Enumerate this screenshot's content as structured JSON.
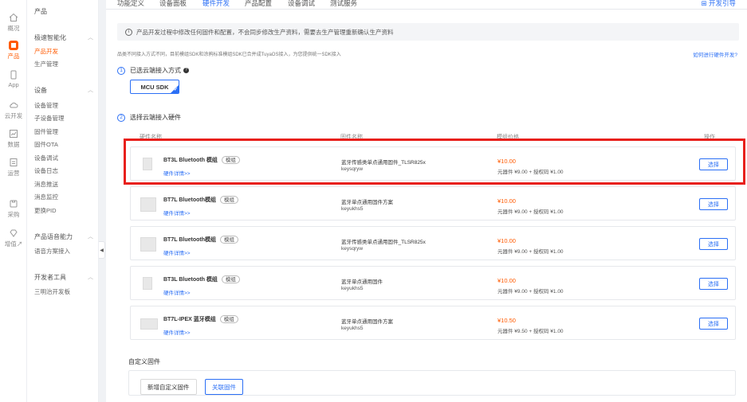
{
  "rail": [
    {
      "label": "概况",
      "icon": "home-icon"
    },
    {
      "label": "产品",
      "icon": "product-icon",
      "active": true
    },
    {
      "label": "App",
      "icon": "phone-icon"
    },
    {
      "label": "云开发",
      "icon": "cloud-icon"
    },
    {
      "label": "数据",
      "icon": "chart-icon"
    },
    {
      "label": "运营",
      "icon": "operation-icon"
    },
    {
      "label": "采购",
      "icon": "purchase-icon"
    },
    {
      "label": "增值",
      "icon": "diamond-icon",
      "suffix": "↗"
    }
  ],
  "sidebar": {
    "title": "产品",
    "groups": [
      {
        "label": "极速智能化",
        "items": [
          "产品开发",
          "生产管理"
        ]
      },
      {
        "label": "设备",
        "items": [
          "设备管理",
          "子设备管理",
          "固件管理",
          "固件OTA",
          "设备调试",
          "设备日志",
          "消息推送",
          "消息监控",
          "更换PID"
        ]
      },
      {
        "label": "产品语音能力",
        "items": [
          "语音方案接入"
        ]
      },
      {
        "label": "开发者工具",
        "items": [
          "三明治开发板"
        ]
      }
    ],
    "active_item": "产品开发"
  },
  "tabs": [
    "功能定义",
    "设备面板",
    "硬件开发",
    "产品配置",
    "设备调试",
    "测试服务"
  ],
  "active_tab": "硬件开发",
  "dev_guide": "开发引导",
  "notice": "产品开发过程中修改任何固件和配置，不会同步修改生产资料，需要去生产管理重新确认生产资料",
  "hint": "品类不同接入方式不同，目前模组SDK和涂鸦标准模组SDK已合并成TuyaOS接入，为您提供统一SDK接入",
  "hint_link": "如何进行硬件开发?",
  "step1": {
    "num": "1",
    "label": "已选云端接入方式",
    "selected": "MCU SDK"
  },
  "step2": {
    "num": "2",
    "label": "选择云端接入硬件"
  },
  "hw_columns": [
    "硬件名称",
    "固件名称",
    "模组价格",
    "操作"
  ],
  "hardware": [
    {
      "name": "BT3L Bluetooth 模组",
      "tag": "模组",
      "detail": "硬件详情>>",
      "firmware": "蓝牙传感类单点通用固件_TLSR825x",
      "code": "keysqryw",
      "price": "¥10.00",
      "breakdown": "元器件 ¥9.00 + 授权码 ¥1.00",
      "action": "选择",
      "thumb": "small"
    },
    {
      "name": "BT7L Bluetooth模组",
      "tag": "模组",
      "detail": "硬件详情>>",
      "firmware": "蓝牙单点通用固件方案",
      "code": "keyukhs5",
      "price": "¥10.00",
      "breakdown": "元器件 ¥9.00 + 授权码 ¥1.00",
      "action": "选择",
      "thumb": "normal"
    },
    {
      "name": "BT7L Bluetooth模组",
      "tag": "模组",
      "detail": "硬件详情>>",
      "firmware": "蓝牙传感类单点通用固件_TLSR825x",
      "code": "keysqryw",
      "price": "¥10.00",
      "breakdown": "元器件 ¥9.00 + 授权码 ¥1.00",
      "action": "选择",
      "thumb": "normal"
    },
    {
      "name": "BT3L Bluetooth 模组",
      "tag": "模组",
      "detail": "硬件详情>>",
      "firmware": "蓝牙单点通用固件",
      "code": "keyukhs5",
      "price": "¥10.00",
      "breakdown": "元器件 ¥9.00 + 授权码 ¥1.00",
      "action": "选择",
      "thumb": "small"
    },
    {
      "name": "BT7L-IPEX 蓝牙模组",
      "tag": "模组",
      "detail": "硬件详情>>",
      "firmware": "蓝牙单点通用固件方案",
      "code": "keyukhs5",
      "price": "¥10.50",
      "breakdown": "元器件 ¥9.50 + 授权码 ¥1.00",
      "action": "选择",
      "thumb": "wide"
    }
  ],
  "custom_firmware": {
    "title": "自定义固件",
    "add_label": "新增自定义固件",
    "link_label": "关联固件"
  },
  "colors": {
    "accent": "#2b6ff5",
    "brand": "#ff5a00",
    "highlight": "#e8201c"
  }
}
